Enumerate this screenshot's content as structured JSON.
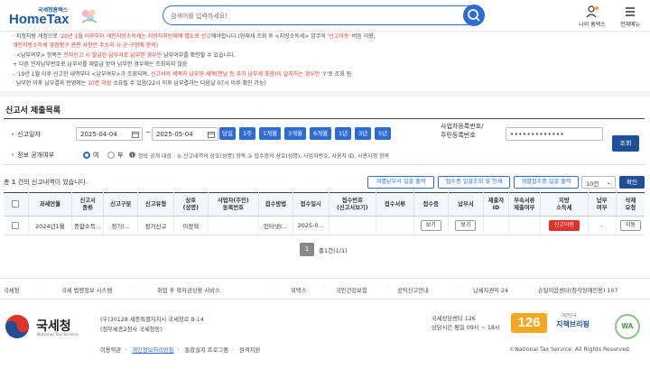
{
  "header": {
    "logo_sub": "국세청홈택스",
    "logo_main": "HomeTax",
    "search_placeholder": "검색어를 입력하세요!",
    "my_label": "나의 홈택스",
    "menu_label": "전체메뉴"
  },
  "notice": {
    "lines": [
      [
        "· 지정처럼 개정으로 ",
        "'20년 1월 이후부터 개인지방소득세는 지방자치단체에 별도로 신고",
        "해야합니다.(현재세 조회 후 <지방소득세> 업무의 ",
        "'신고이동'",
        " 버튼 이용,"
      ],
      [
        "",
        "개인지방소득세 경정청구 관련 사항은 주소지 시·군·구청에 문의)",
        "",
        "",
        ""
      ],
      [
        "· <납부여부> 항목은 ",
        "전자신고 시 발급된 납부서로 납부한 경우만",
        " 납부여부를 확인할 수 있습니다.",
        "",
        ""
      ],
      [
        "  + 다른 전자납부번호로 납부서를 재발급 받아 납부한 경우에는 조회되지 않음",
        "",
        "",
        "",
        ""
      ],
      [
        "  - '19년 1월 이후 신고한 내역부터 <납부여부>가 조회되며, ",
        "신고서의 세액과 납부한 세액(분납 등 추가 납부세 포함)이 일치하는 경우만",
        " 'Y'로 조회 됨",
        "",
        ""
      ],
      [
        "· 납부한 이후 납부결과 반영에는 ",
        "10분 이상",
        " 소요될 수 있음(22시 이후 납부결과는 다음날 07시 이후 확인 가능)",
        "",
        ""
      ]
    ]
  },
  "section_title": "신고서 제출목록",
  "form": {
    "date_label": "신고일자",
    "start_date": "2025-04-04",
    "end_date": "2025-05-04",
    "tilde": "~",
    "period_buttons": [
      "당일",
      "1주",
      "1개월",
      "3개월",
      "6개월",
      "1년",
      "3년",
      "5년"
    ],
    "disclose_label": "정보 공개여부",
    "radio_yes": "여",
    "radio_no": "부",
    "disclose_info": "정보 공개 대상 : ① 신고내역의 상호(성명) 항목 ② 접수증의 상호(성명), 사업자번호, 사용자 ID, 사용자명 항목",
    "biz_label_1": "사업자등록번호/",
    "biz_label_2": "주민등록번호",
    "biz_value": "•••••••••••••",
    "query_button": "조회"
  },
  "results": {
    "count_prefix": "총 ",
    "count": "1",
    "count_suffix": " 건의 신고내역이 있습니다.",
    "buttons": [
      "개별납부서 일괄 출력",
      "접수증 일괄조회 및 인쇄",
      "개별접수증 일괄 출력"
    ],
    "page_size": "10건",
    "ok_button": "확인"
  },
  "table": {
    "headers": [
      "",
      "과세연월",
      "신고서\n종류",
      "신고구분",
      "신고유형",
      "상호\n(성명)",
      "사업자(주민)\n등록번호",
      "접수방법",
      "접수일시",
      "접수번호\n(신고서보기)",
      "접수서류",
      "접수증",
      "납부서",
      "제출자\nID",
      "부속서류\n제출여부",
      "지방\n소득세",
      "납부\n여부",
      "삭제\n요청"
    ],
    "row": {
      "period": "2024년1월",
      "kind": "종합소득…",
      "division": "정기(…",
      "type": "정기신고",
      "name": "이정혁",
      "regno": "",
      "method": "인터넷(…",
      "datetime": "2025-0…",
      "receipt_no": "",
      "docs": "",
      "receipt_btn": "보기",
      "payment_btn": "보기",
      "submitter": "",
      "attach": "",
      "local_tax_btn": "신고이동",
      "paid": "-",
      "delete_btn": "이동"
    }
  },
  "pagination": {
    "current": "1",
    "total": "총1건(1/1)"
  },
  "footer_links": [
    "국세청",
    "국세 법령정보 시스템",
    "취업 후 학자금상환 서비스",
    "위택스",
    "국민건강보험",
    "공익신고안내",
    "납세자권익 24",
    "손탈이음센터(청각장애인용) 107"
  ],
  "footer": {
    "nts_name": "국세청",
    "nts_eng": "National Tax Service",
    "address_1": "(우)30128 세종특별자치시 국세청로 8-14",
    "address_2": "(정부세종2청사 국세청동)",
    "policy_links": [
      "이용약관",
      "개인정보처리방침",
      "통합설치 프로그램",
      "원격지원"
    ],
    "center_name": "국세상담센터 126",
    "center_hours": "상담시간 평일 09시 ~ 18시",
    "copyright": "©National Tax Service. All Rights Reserved.",
    "n126": "126",
    "jichak_top": "대한민국",
    "jichak": "지책브리핑",
    "wa": "WA"
  },
  "colors": {
    "primary": "#2e6bd7",
    "dark_btn": "#1f4f96",
    "accent_red": "#e1322b"
  }
}
